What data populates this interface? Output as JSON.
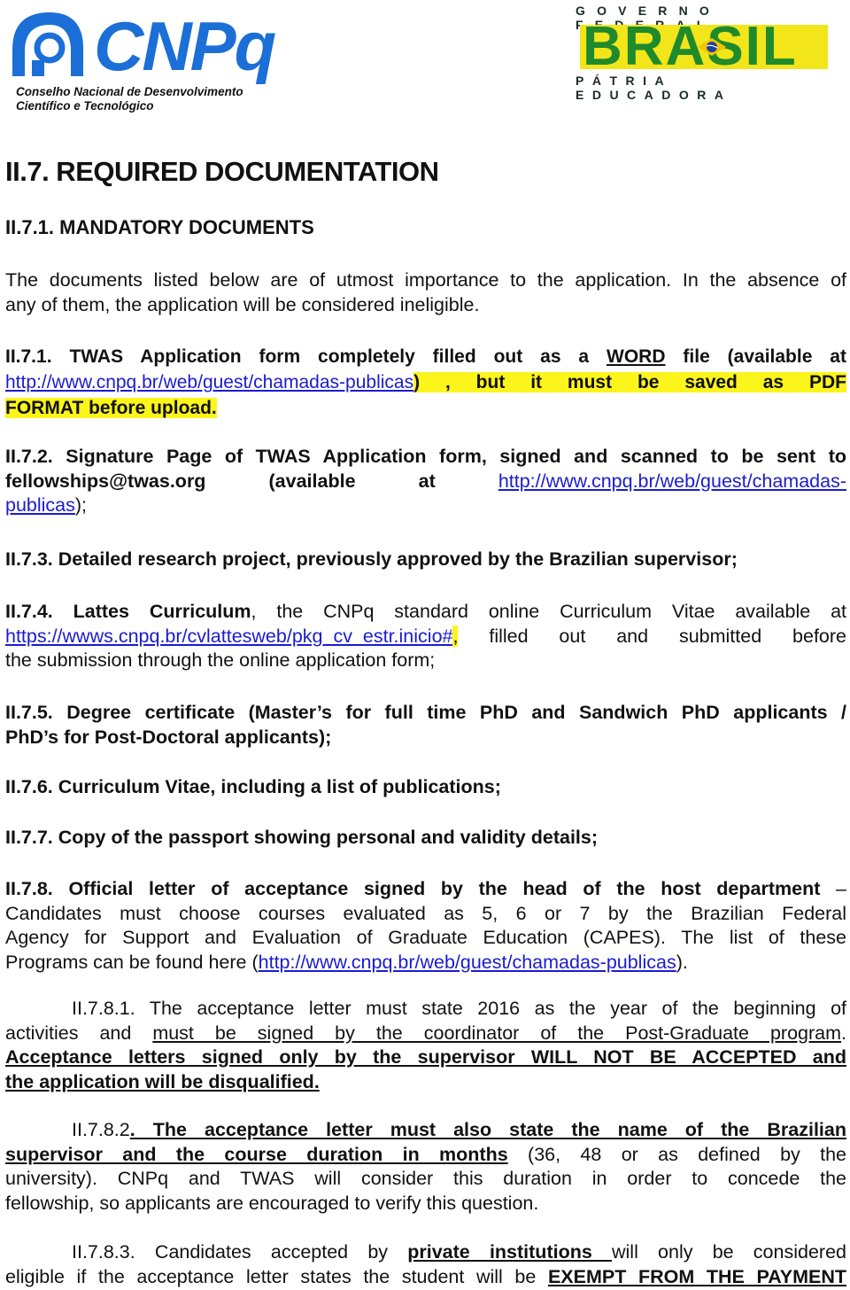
{
  "header": {
    "left_logo": {
      "name": "CNPq",
      "subtitle_line1": "Conselho Nacional de Desenvolvimento",
      "subtitle_line2": "Científico e Tecnológico",
      "brand_color": "#1b6fd6"
    },
    "right_logo": {
      "top": "GOVERNO FEDERAL",
      "word": "BRASIL",
      "bottom": "PÁTRIA EDUCADORA",
      "green": "#1f8a2c",
      "yellow": "#f2e519"
    }
  },
  "document": {
    "title": "II.7. REQUIRED DOCUMENTATION",
    "subtitle": "II.7.1. MANDATORY DOCUMENTS",
    "intro": {
      "l1": "The documents listed below are of utmost importance to the application. In the absence of",
      "l2": "any of them, the application will be considered ineligible."
    },
    "item1": {
      "a": "II.7.1.  TWAS  Application  form  completely  filled  out  as  a ",
      "word": "WORD",
      "b": " file  (available  at",
      "link": "http://www.cnpq.br/web/guest/chamadas-publicas",
      "c": ")",
      "hl": " ,  but  it  must  be  saved  as  PDF",
      "hl2": "FORMAT before upload."
    },
    "item2": {
      "a": "II.7.2. Signature Page of TWAS Application form, signed and scanned to be sent to",
      "b": "fellowships@twas.org    (available    at    ",
      "link1": "http://www.cnpq.br/web/guest/chamadas-",
      "link2": "publicas",
      "c": ");"
    },
    "item3": "II.7.3. Detailed research project, previously approved by the Brazilian supervisor;",
    "item4": {
      "bold": "II.7.4. Lattes Curriculum",
      "a": ", the CNPq standard online Curriculum Vitae available at",
      "link": "https://wwws.cnpq.br/cvlattesweb/pkg_cv_estr.inicio#",
      "hl": ",",
      "b": " filled out and submitted before",
      "c": "the submission through the online application form;"
    },
    "item5": {
      "l1": "II.7.5. Degree certificate (Master’s for full time PhD and Sandwich PhD applicants /",
      "l2": "PhD’s for Post-Doctoral applicants);"
    },
    "item6": "II.7.6. Curriculum Vitae, including a list of publications;",
    "item7": "II.7.7. Copy of the passport showing personal and validity details;",
    "item8": {
      "bold": "II.7.8. Official letter of acceptance signed by the head of the host department",
      "dash": " –",
      "l2": "Candidates must choose courses evaluated as 5, 6 or 7 by the Brazilian Federal",
      "l3": "Agency for Support and Evaluation of Graduate Education (CAPES). The list of these",
      "l4a": "Programs can be found here (",
      "link": "http://www.cnpq.br/web/guest/chamadas-publicas",
      "l4b": ")."
    },
    "item81": {
      "l1": "II.7.8.1. The acceptance letter must state 2016 as the year of the beginning of",
      "l2a": "activities and ",
      "l2u": "must be signed by the coordinator of the Post-Graduate program",
      "l2b": ".",
      "l3": "Acceptance letters signed only by the supervisor WILL NOT BE ACCEPTED and",
      "l4": "the application will be disqualified."
    },
    "item82": {
      "num": "II.7.8.2",
      "l1u": ". The acceptance letter must also state the name of the Brazilian",
      "l2u": "supervisor and the course duration in months",
      "l2b": " (36, 48 or as defined by the",
      "l3": "university). CNPq and TWAS will consider this duration in order to concede the",
      "l4": "fellowship, so applicants are encouraged to verify this question."
    },
    "item83": {
      "l1a": "II.7.8.3. Candidates accepted by ",
      "l1u": "private institutions ",
      "l1b": "will only be considered",
      "l2a": "eligible if the acceptance letter states the student will be ",
      "l2u": "EXEMPT FROM THE PAYMENT"
    }
  }
}
